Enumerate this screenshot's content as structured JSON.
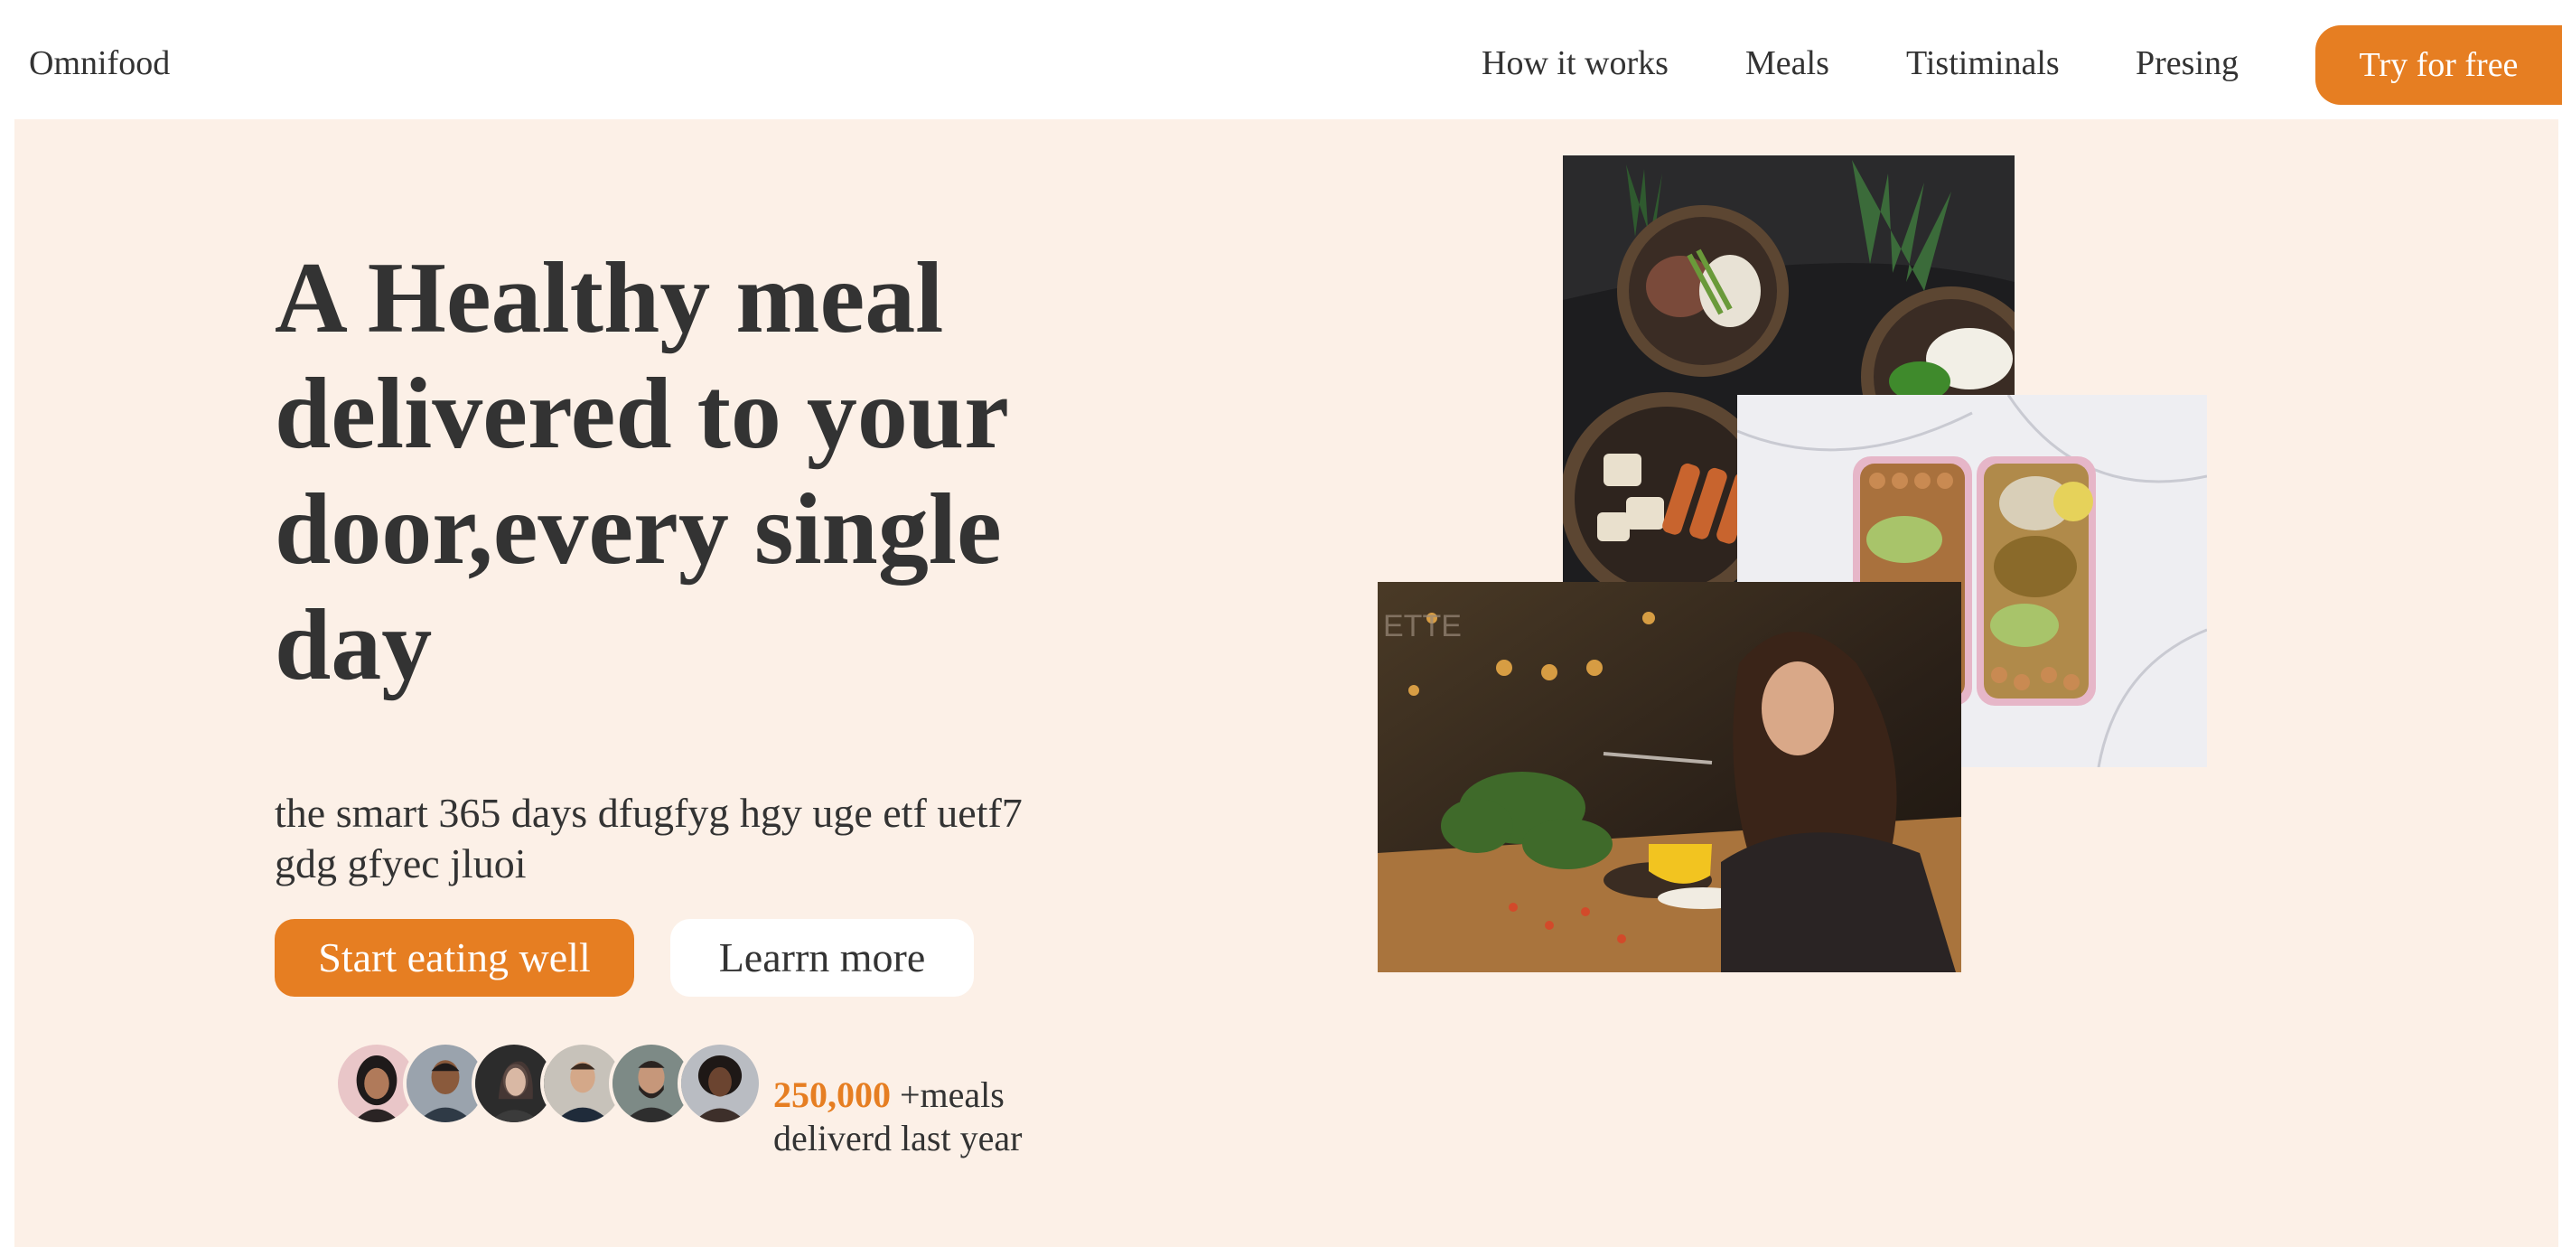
{
  "header": {
    "logo": "Omnifood",
    "nav": {
      "how_it_works": "How it works",
      "meals": "Meals",
      "testimonials": "Tistiminals",
      "pricing": "Presing",
      "cta": "Try for free"
    }
  },
  "hero": {
    "headline": "A Healthy meal delivered to your door,every single day",
    "description": "the smart 365 days dfugfyg hgy uge etf uetf7 gdg gfyec jluoi",
    "primary_button": "Start eating well",
    "secondary_button": "Learrn more",
    "delivered": {
      "count": "250,000",
      "text": " +meals deliverd last year"
    }
  },
  "colors": {
    "accent": "#e67e22",
    "hero_background": "#fcf0e7",
    "text": "#333333"
  },
  "icons": [
    "customer-avatar",
    "food-photo"
  ]
}
